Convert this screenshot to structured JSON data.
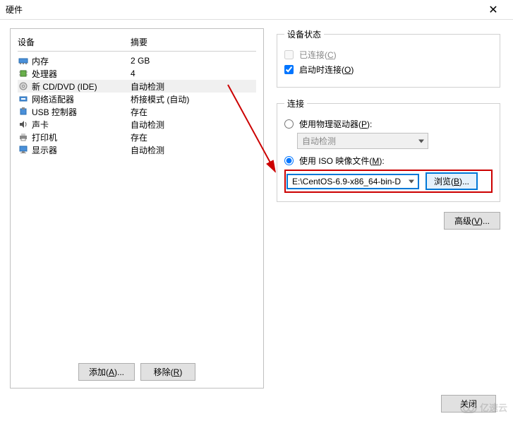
{
  "window": {
    "title": "硬件"
  },
  "deviceTable": {
    "headers": {
      "device": "设备",
      "summary": "摘要"
    },
    "rows": [
      {
        "name": "内存",
        "summary": "2 GB"
      },
      {
        "name": "处理器",
        "summary": "4"
      },
      {
        "name": "新 CD/DVD (IDE)",
        "summary": "自动检测"
      },
      {
        "name": "网络适配器",
        "summary": "桥接模式 (自动)"
      },
      {
        "name": "USB 控制器",
        "summary": "存在"
      },
      {
        "name": "声卡",
        "summary": "自动检测"
      },
      {
        "name": "打印机",
        "summary": "存在"
      },
      {
        "name": "显示器",
        "summary": "自动检测"
      }
    ]
  },
  "buttons": {
    "add": "添加(A)...",
    "remove": "移除(R)",
    "browse": "浏览(B)...",
    "advanced": "高级(V)...",
    "close": "关闭"
  },
  "deviceStatus": {
    "legend": "设备状态",
    "connected": "已连接(C)",
    "connectOnStart": "启动时连接(O)"
  },
  "connection": {
    "legend": "连接",
    "usePhysical": "使用物理驱动器(P):",
    "autoDetect": "自动检测",
    "useIso": "使用 ISO 映像文件(M):",
    "isoPath": "E:\\CentOS-6.9-x86_64-bin-D"
  },
  "watermark": "亿速云"
}
